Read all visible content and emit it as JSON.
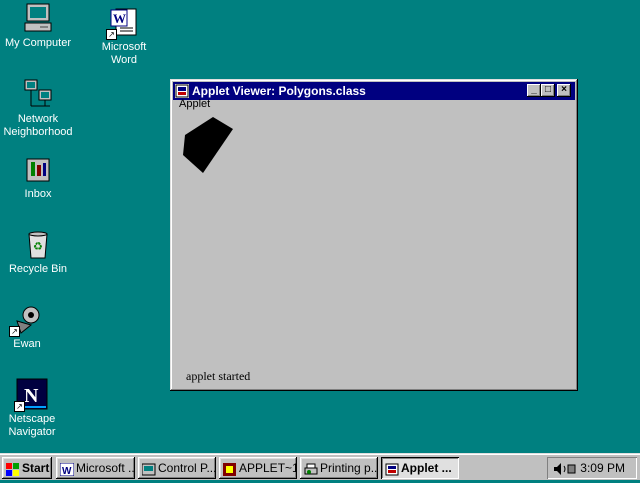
{
  "desktop": {
    "icons": [
      {
        "label": "My Computer"
      },
      {
        "label": "Microsoft\nWord"
      },
      {
        "label": "Network\nNeighborhood"
      },
      {
        "label": "Inbox"
      },
      {
        "label": "Recycle Bin"
      },
      {
        "label": "Ewan"
      },
      {
        "label": "Netscape\nNavigator"
      }
    ]
  },
  "window": {
    "title": "Applet Viewer: Polygons.class",
    "menu": [
      "Applet"
    ],
    "status": "applet started",
    "controls": {
      "minimize": "_",
      "maximize": "□",
      "close": "×"
    }
  },
  "taskbar": {
    "start": "Start",
    "buttons": [
      {
        "label": "Microsoft ...",
        "icon": "word-icon"
      },
      {
        "label": "Control P...",
        "icon": "control-panel-icon"
      },
      {
        "label": "APPLET~1",
        "icon": "applet-folder-icon"
      },
      {
        "label": "Printing p...",
        "icon": "printer-icon"
      },
      {
        "label": "Applet ...",
        "icon": "java-applet-icon",
        "active": true
      }
    ],
    "clock": "3:09 PM"
  },
  "colors": {
    "desktop": "#008080",
    "titlebar": "#000080",
    "face": "#c0c0c0"
  }
}
